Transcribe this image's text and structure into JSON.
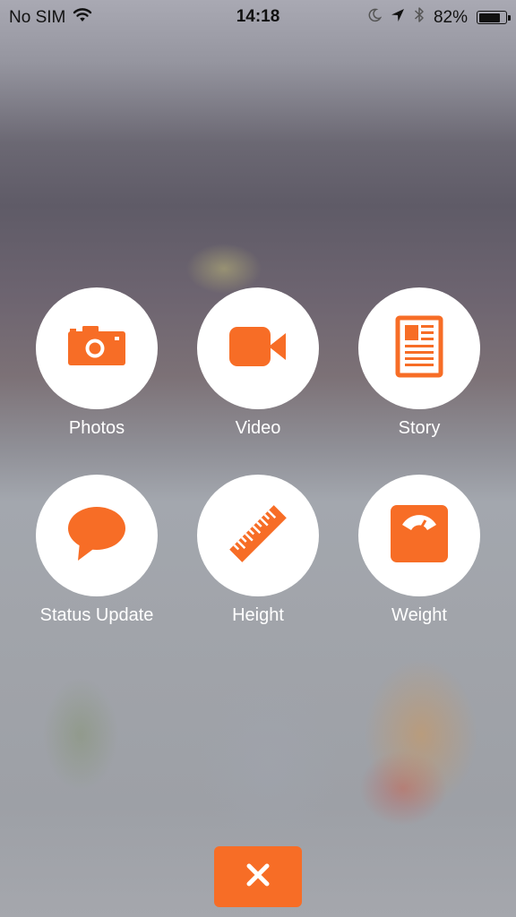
{
  "status_bar": {
    "carrier": "No SIM",
    "time": "14:18",
    "battery_percent_label": "82%",
    "battery_level": 0.82,
    "icons": [
      "wifi-icon",
      "moon-icon",
      "location-arrow-icon",
      "bluetooth-icon",
      "battery-icon"
    ]
  },
  "actions": [
    {
      "label": "Photos",
      "icon": "camera-icon"
    },
    {
      "label": "Video",
      "icon": "video-camera-icon"
    },
    {
      "label": "Story",
      "icon": "document-icon"
    },
    {
      "label": "Status Update",
      "icon": "speech-bubble-icon"
    },
    {
      "label": "Height",
      "icon": "ruler-icon"
    },
    {
      "label": "Weight",
      "icon": "scale-icon"
    }
  ],
  "close_button": {
    "icon": "close-icon"
  },
  "colors": {
    "accent": "#f76d26",
    "circle": "#ffffff",
    "label_text": "#ffffff"
  }
}
